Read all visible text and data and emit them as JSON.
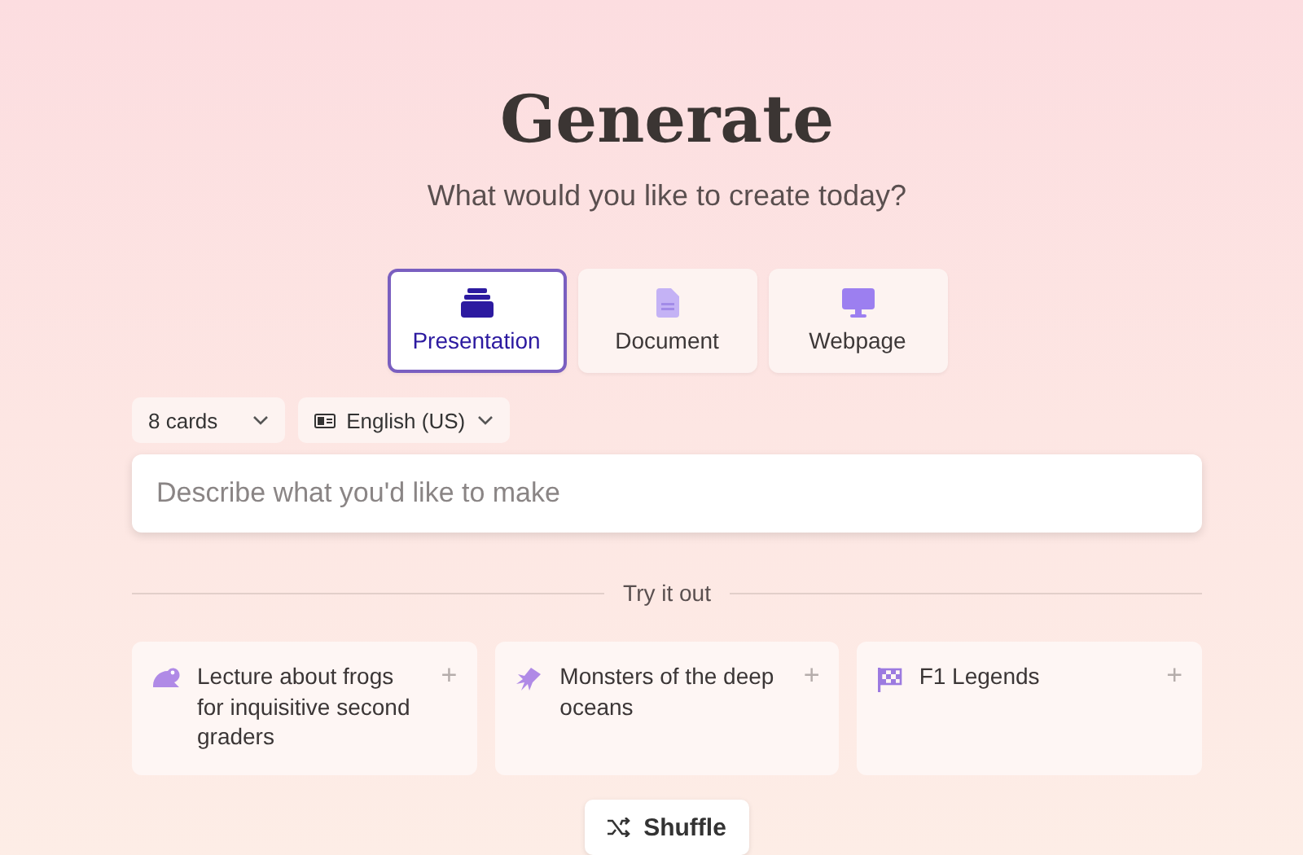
{
  "title": "Generate",
  "subtitle": "What would you like to create today?",
  "tabs": [
    {
      "label": "Presentation",
      "selected": true
    },
    {
      "label": "Document",
      "selected": false
    },
    {
      "label": "Webpage",
      "selected": false
    }
  ],
  "options": [
    {
      "kind": "count",
      "value": "8 cards"
    },
    {
      "kind": "language",
      "value": "English (US)"
    }
  ],
  "prompt": {
    "placeholder": "Describe what you'd like to make"
  },
  "divider_label": "Try it out",
  "examples": [
    {
      "text": "Lecture about frogs for inquisitive second graders",
      "action": "+"
    },
    {
      "text": "Monsters of the deep oceans",
      "action": "+"
    },
    {
      "text": "F1 Legends",
      "action": "+"
    }
  ],
  "shuffle": {
    "label": "Shuffle"
  }
}
